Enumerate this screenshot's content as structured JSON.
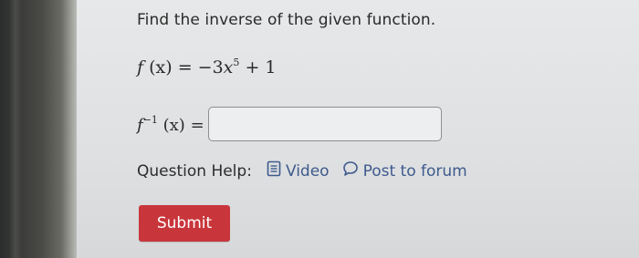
{
  "question": {
    "prompt": "Find the inverse of the given function."
  },
  "function": {
    "name": "f",
    "arg": "(x)",
    "equals": "=",
    "rhs_coef": "−3",
    "rhs_var": "x",
    "rhs_exp": "5",
    "rhs_tail": "+ 1"
  },
  "answer": {
    "name": "f",
    "exp": "−1",
    "arg": "(x)",
    "equals": "=",
    "value": "",
    "placeholder": ""
  },
  "help": {
    "label": "Question Help:",
    "video_label": "Video",
    "forum_label": "Post to forum"
  },
  "submit": {
    "label": "Submit"
  },
  "colors": {
    "link": "#3f5a8c",
    "submit_bg": "#c8363c",
    "text": "#2a2a2a"
  },
  "icons": {
    "video": "document-icon",
    "forum": "speech-bubble-icon"
  }
}
